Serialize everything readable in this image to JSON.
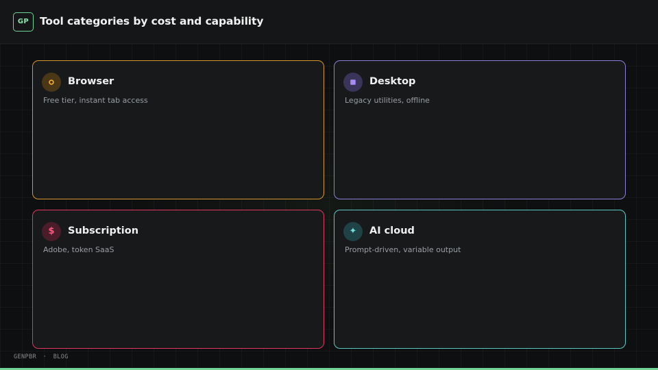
{
  "header": {
    "logo_text": "GP",
    "title": "Tool categories by cost and capability"
  },
  "cards": [
    {
      "title": "Browser",
      "description": "Free tier, instant tab access",
      "icon": "ring-icon",
      "color": "#d8972a"
    },
    {
      "title": "Desktop",
      "description": "Legacy utilities, offline",
      "icon": "square-icon",
      "color": "#8f7fdc"
    },
    {
      "title": "Subscription",
      "description": "Adobe, token SaaS",
      "icon": "dollar-icon",
      "icon_glyph": "$",
      "color": "#e0385f"
    },
    {
      "title": "AI cloud",
      "description": "Prompt-driven, variable output",
      "icon": "sparkle-icon",
      "icon_glyph": "✦",
      "color": "#5cc9c4"
    }
  ],
  "footer": {
    "brand": "GENPBR",
    "separator": "·",
    "section": "BLOG"
  },
  "colors": {
    "accent": "#6fd39a",
    "background": "#0e0f10",
    "card_background": "#18191b"
  }
}
